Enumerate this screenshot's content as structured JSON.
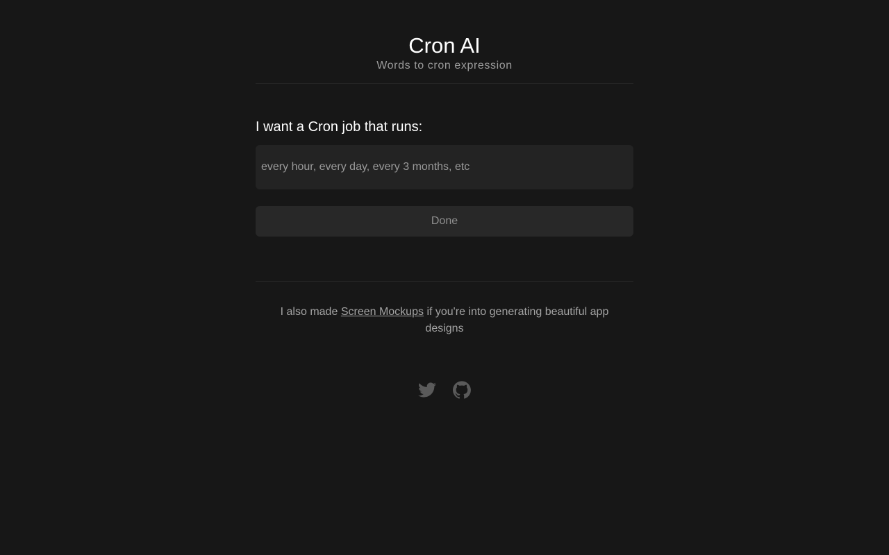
{
  "header": {
    "title": "Cron AI",
    "subtitle": "Words to cron expression"
  },
  "form": {
    "label": "I want a Cron job that runs:",
    "input_value": "",
    "input_placeholder": "every hour, every day, every 3 months, etc",
    "submit_label": "Done"
  },
  "promo": {
    "prefix": "I also made",
    "link_text": "Screen Mockups",
    "suffix": "if you're into generating beautiful app designs"
  },
  "socials": [
    {
      "icon": "twitter-icon"
    },
    {
      "icon": "github-icon"
    }
  ],
  "colors": {
    "background": "#171717",
    "input_bg": "#232323",
    "button_bg": "#282828",
    "text_primary": "#ffffff",
    "text_muted": "#9c9c9c",
    "icon": "#5a5a5a"
  }
}
